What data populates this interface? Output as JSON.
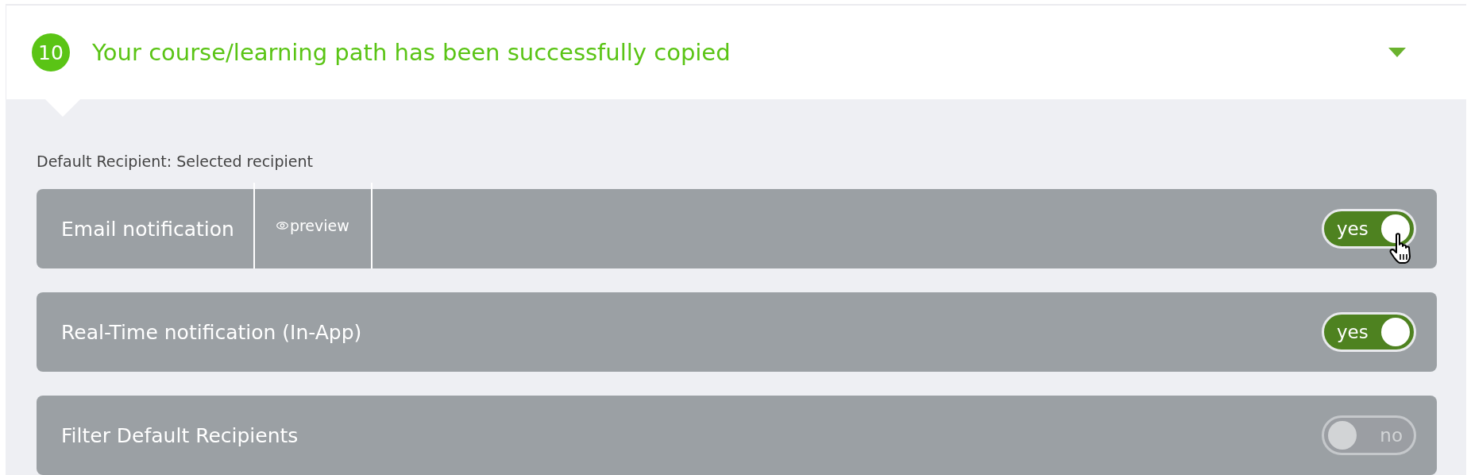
{
  "step": {
    "number": "10",
    "title": "Your course/learning path has been successfully copied",
    "expanded": true
  },
  "default_recipient": "Default Recipient: Selected recipient",
  "rows": [
    {
      "label": "Email notification",
      "preview": "preview",
      "toggle": {
        "on": true,
        "label": "yes"
      }
    },
    {
      "label": "Real-Time notification (In-App)",
      "toggle": {
        "on": true,
        "label": "yes"
      }
    },
    {
      "label": "Filter Default Recipients",
      "toggle": {
        "on": false,
        "label": "no"
      }
    }
  ]
}
